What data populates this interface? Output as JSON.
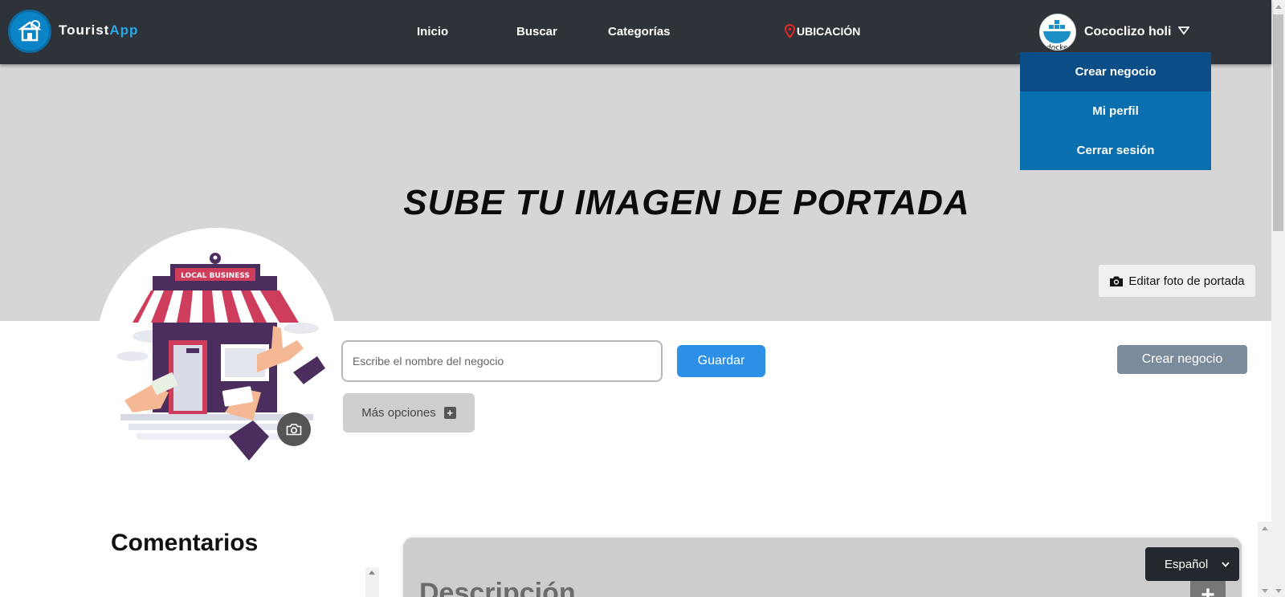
{
  "app": {
    "logo_prefix": "Tourist",
    "logo_accent": "App",
    "brand_color": "#0a84c6"
  },
  "nav": {
    "inicio": "Inicio",
    "buscar": "Buscar",
    "categorias": "Categorías",
    "ubicacion": "UBICACIÓN",
    "user_name": "Cococlizo holi"
  },
  "dropdown": {
    "items": [
      "Crear negocio",
      "Mi perfil",
      "Cerrar sesión"
    ],
    "active_index": 0
  },
  "cover": {
    "title": "SUBE TU IMAGEN DE PORTADA",
    "edit_label": "Editar foto de portada"
  },
  "profile": {
    "sign_text": "LOCAL BUSINESS"
  },
  "form": {
    "name_placeholder": "Escribe el nombre del negocio",
    "name_value": "",
    "save_label": "Guardar",
    "more_label": "Más opciones",
    "create_label": "Crear negocio"
  },
  "comments": {
    "title": "Comentarios"
  },
  "description": {
    "title": "Descripción"
  },
  "language": {
    "selected": "Español"
  },
  "icons": {
    "location": "map-pin-icon",
    "camera": "camera-icon",
    "chevron": "chevron-down-icon",
    "plus": "plus-icon"
  },
  "colors": {
    "navbar": "#2e3239",
    "dropdown": "#0a6fae",
    "dropdown_active": "#0b4d86",
    "save_button": "#2c90e6",
    "create_button": "#7a8b9b",
    "location_pin": "#e0292a"
  }
}
